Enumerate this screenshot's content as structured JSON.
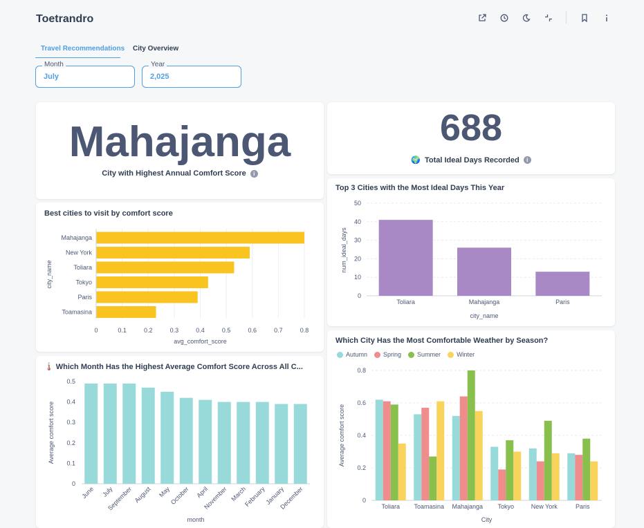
{
  "app": {
    "title": "Toetrandro"
  },
  "toolbar_icons": [
    "share-icon",
    "clock-icon",
    "moon-icon",
    "minimize-icon",
    "bookmark-icon",
    "info-icon"
  ],
  "tabs": [
    {
      "label": "Travel Recommendations",
      "active": true
    },
    {
      "label": "City Overview",
      "active": false
    }
  ],
  "filters": {
    "month": {
      "label": "Month",
      "value": "July"
    },
    "year": {
      "label": "Year",
      "value": "2,025"
    }
  },
  "scalar_city": {
    "value": "Mahajanga",
    "caption": "City with Highest Annual Comfort Score"
  },
  "scalar_days": {
    "value": "688",
    "caption": "Total Ideal Days Recorded",
    "emoji": "🌍"
  },
  "colors": {
    "accent": "#509ee3",
    "yellow": "#f9c41f",
    "purple": "#a989c5",
    "teal": "#98d9d9",
    "autumn": "#98d9d9",
    "spring": "#ef8c8c",
    "summer": "#88bf4d",
    "winter": "#f9d45c"
  },
  "chart_data": [
    {
      "id": "comfort_by_city",
      "type": "bar",
      "orientation": "horizontal",
      "title": "Best cities to visit by comfort score",
      "xlabel": "avg_comfort_score",
      "ylabel": "city_name",
      "categories": [
        "Mahajanga",
        "New York",
        "Toliara",
        "Tokyo",
        "Paris",
        "Toamasina"
      ],
      "values": [
        0.8,
        0.59,
        0.53,
        0.43,
        0.39,
        0.23
      ],
      "xlim": [
        0,
        0.8
      ],
      "ticks": [
        "0",
        "0.1",
        "0.2",
        "0.3",
        "0.4",
        "0.5",
        "0.6",
        "0.7",
        "0.8"
      ],
      "grid": true
    },
    {
      "id": "ideal_days",
      "type": "bar",
      "title": "Top 3 Cities with the Most Ideal Days This Year",
      "xlabel": "city_name",
      "ylabel": "num_ideal_days",
      "categories": [
        "Toliara",
        "Mahajanga",
        "Paris"
      ],
      "values": [
        41,
        26,
        13
      ],
      "ylim": [
        0,
        50
      ],
      "ticks": [
        "0",
        "10",
        "20",
        "30",
        "40",
        "50"
      ],
      "grid": true
    },
    {
      "id": "month_comfort",
      "type": "bar",
      "title": "Which Month Has the Highest Average Comfort Score Across All C...",
      "title_emoji": "🌡️",
      "xlabel": "month",
      "ylabel": "Average comfort score",
      "categories": [
        "June",
        "July",
        "September",
        "August",
        "May",
        "October",
        "April",
        "November",
        "March",
        "February",
        "January",
        "December"
      ],
      "values": [
        0.49,
        0.49,
        0.49,
        0.47,
        0.45,
        0.42,
        0.41,
        0.4,
        0.4,
        0.4,
        0.39,
        0.39
      ],
      "ylim": [
        0,
        0.5
      ],
      "ticks": [
        "0",
        "0.1",
        "0.2",
        "0.3",
        "0.4",
        "0.5"
      ],
      "grid": true
    },
    {
      "id": "season_comfort",
      "type": "bar",
      "title": "Which City Has the Most Comfortable Weather by Season?",
      "xlabel": "City",
      "ylabel": "Average comfort score",
      "categories": [
        "Toliara",
        "Toamasina",
        "Mahajanga",
        "Tokyo",
        "New York",
        "Paris"
      ],
      "series": [
        {
          "name": "Autumn",
          "values": [
            0.62,
            0.53,
            0.52,
            0.33,
            0.32,
            0.29
          ]
        },
        {
          "name": "Spring",
          "values": [
            0.61,
            0.57,
            0.64,
            0.19,
            0.24,
            0.28
          ]
        },
        {
          "name": "Summer",
          "values": [
            0.59,
            0.27,
            0.8,
            0.37,
            0.49,
            0.38
          ]
        },
        {
          "name": "Winter",
          "values": [
            0.35,
            0.61,
            0.55,
            0.3,
            0.29,
            0.24
          ]
        }
      ],
      "ylim": [
        0,
        0.8
      ],
      "ticks": [
        "0",
        "0.2",
        "0.4",
        "0.6",
        "0.8"
      ],
      "legend": "top-left",
      "grid": true
    }
  ]
}
